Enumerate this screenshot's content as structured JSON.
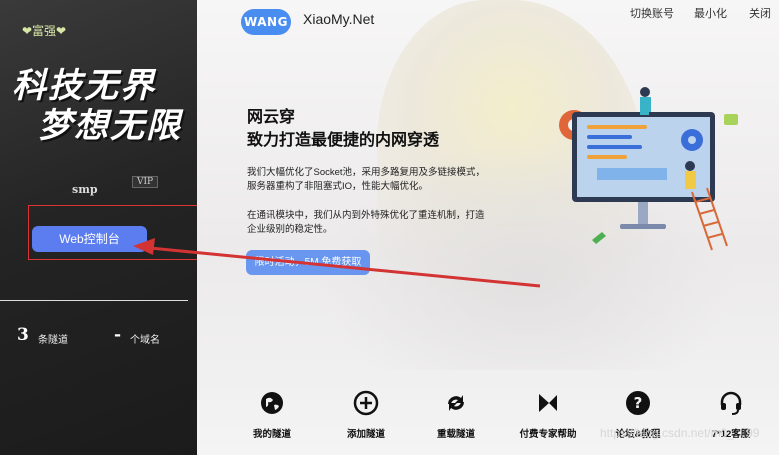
{
  "sidebar": {
    "badge": "❤富强❤",
    "slogan_line1": "科技无界",
    "slogan_line2": "梦想无限",
    "username": "smp",
    "vip": "VIP",
    "web_console_label": "Web控制台",
    "stats": [
      {
        "value": "3",
        "label": "条隧道"
      },
      {
        "value": "-",
        "label": "个域名"
      }
    ]
  },
  "header": {
    "logo_text": "WANG",
    "site_name": "XiaoMy.Net",
    "actions": [
      "切换账号",
      "最小化",
      "关闭"
    ]
  },
  "hero": {
    "title_line1": "网云穿",
    "title_line2": "致力打造最便捷的内网穿透",
    "desc1_line1": "我们大幅优化了Socket池，采用多路复用及多链接模式，",
    "desc1_line2": "服务器重构了非阻塞式IO，性能大幅优化。",
    "desc2_line1": "在通讯模块中，我们从内到外特殊优化了重连机制，打造",
    "desc2_line2": "企业级别的稳定性。",
    "promo_label": "限时活动，5M 免费获取"
  },
  "features": [
    {
      "icon": "globe-icon",
      "label": "我的隧道"
    },
    {
      "icon": "plus-circle-icon",
      "label": "添加隧道"
    },
    {
      "icon": "reload-icon",
      "label": "重载隧道"
    },
    {
      "icon": "expert-icon",
      "label": "付费专家帮助"
    },
    {
      "icon": "question-icon",
      "label": "论坛&教程"
    },
    {
      "icon": "headset-icon",
      "label": "7*12客服"
    }
  ],
  "watermark": "https://blog.csdn.net/m0_…99",
  "colors": {
    "sidebar_bg": "#242424",
    "accent_blue": "#5b7df0",
    "annotation_red": "#d33333"
  }
}
